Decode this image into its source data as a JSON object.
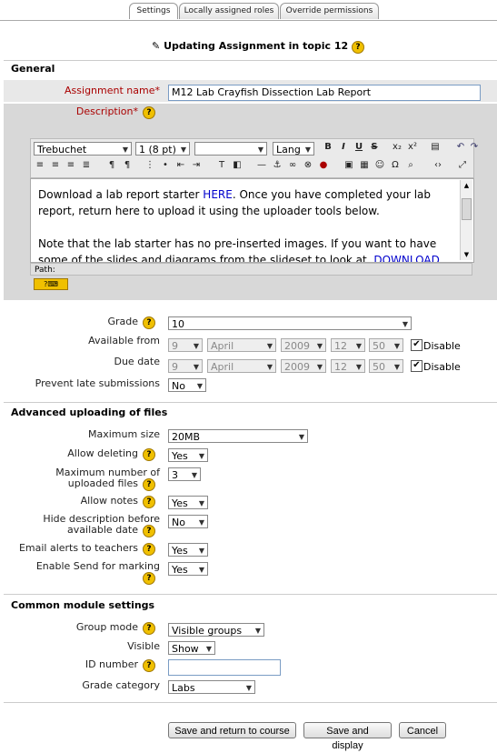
{
  "tabs": [
    "Settings",
    "Locally assigned roles",
    "Override permissions"
  ],
  "heading": "Updating Assignment in topic 12",
  "general": {
    "section_title": "General",
    "assignment_name_label": "Assignment name",
    "assignment_name_value": "M12 Lab Crayfish Dissection Lab Report",
    "description_label": "Description",
    "editor": {
      "font": "Trebuchet",
      "size": "1 (8 pt)",
      "format": "",
      "lang": "Lang",
      "text_prefix": "Download a lab report starter ",
      "link1": "HERE",
      "text_mid": ". Once you have completed your lab report, return here to upload it using the uploader tools below.",
      "text_para2": "Note that the lab starter has no pre-inserted images. If you want to have some of the slides and diagrams from the slideset to look at, ",
      "link2": "DOWNLOAD",
      "path_label": "Path:"
    },
    "grade_label": "Grade",
    "grade_value": "10",
    "available_from_label": "Available from",
    "due_date_label": "Due date",
    "available_from": {
      "day": "9",
      "month": "April",
      "year": "2009",
      "hour": "12",
      "minute": "50"
    },
    "due_date": {
      "day": "9",
      "month": "April",
      "year": "2009",
      "hour": "12",
      "minute": "50"
    },
    "disable_label": "Disable",
    "prevent_late_label": "Prevent late submissions",
    "prevent_late_value": "No"
  },
  "advanced": {
    "section_title": "Advanced uploading of files",
    "max_size_label": "Maximum size",
    "max_size_value": "20MB",
    "allow_deleting_label": "Allow deleting",
    "allow_deleting_value": "Yes",
    "max_files_label_1": "Maximum number of",
    "max_files_label_2": "uploaded files",
    "max_files_value": "3",
    "allow_notes_label": "Allow notes",
    "allow_notes_value": "Yes",
    "hide_desc_label_1": "Hide description before",
    "hide_desc_label_2": "available date",
    "hide_desc_value": "No",
    "email_alerts_label": "Email alerts to teachers",
    "email_alerts_value": "Yes",
    "enable_send_label": "Enable Send for marking",
    "enable_send_value": "Yes"
  },
  "common": {
    "section_title": "Common module settings",
    "group_mode_label": "Group mode",
    "group_mode_value": "Visible groups",
    "visible_label": "Visible",
    "visible_value": "Show",
    "id_number_label": "ID number",
    "id_number_value": "",
    "grade_category_label": "Grade category",
    "grade_category_value": "Labs"
  },
  "buttons": {
    "save_return": "Save and return to course",
    "save_display": "Save and display",
    "cancel": "Cancel"
  },
  "help_glyph": "?",
  "required_glyph": "*",
  "colors": {
    "required": "#aa0000",
    "link": "#0000cc",
    "help": "#f0c000"
  }
}
